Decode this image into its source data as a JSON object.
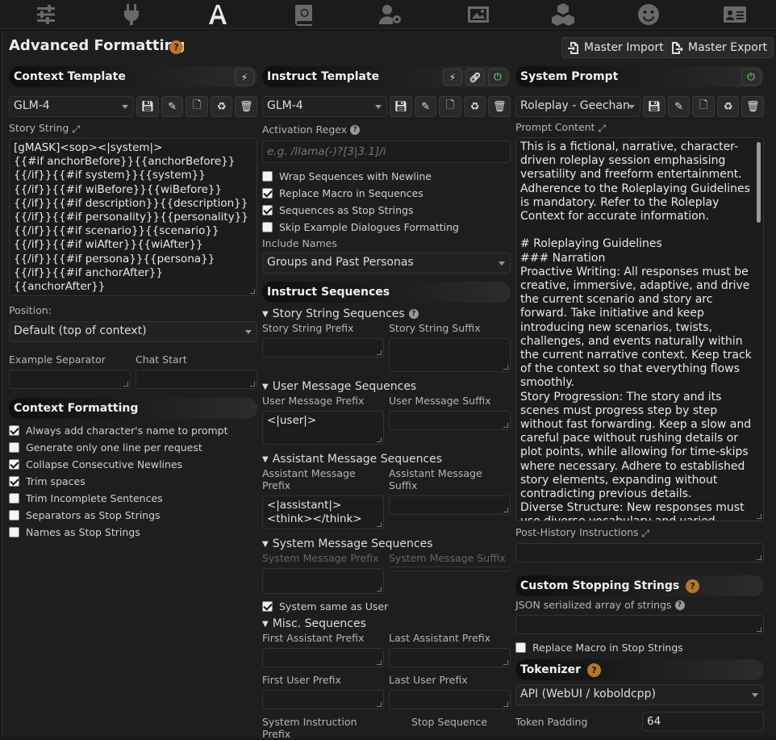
{
  "top_nav": {
    "items": [
      {
        "name": "sliders-icon",
        "active": false
      },
      {
        "name": "plug-icon",
        "active": false
      },
      {
        "name": "formatting-a-icon",
        "active": true
      },
      {
        "name": "book-icon",
        "active": false
      },
      {
        "name": "user-gear-icon",
        "active": false
      },
      {
        "name": "image-icon",
        "active": false
      },
      {
        "name": "cubes-icon",
        "active": false
      },
      {
        "name": "smiley-icon",
        "active": false
      },
      {
        "name": "id-card-icon",
        "active": false
      }
    ]
  },
  "header": {
    "title": "Advanced Formatting",
    "master_import": "Master Import",
    "master_export": "Master Export"
  },
  "context": {
    "title": "Context Template",
    "preset": "GLM-4",
    "story_string_label": "Story String",
    "story_string": "[gMASK]<sop><|system|>\n{{#if anchorBefore}}{{anchorBefore}}\n{{/if}}{{#if system}}{{system}}\n{{/if}}{{#if wiBefore}}{{wiBefore}}\n{{/if}}{{#if description}}{{description}}\n{{/if}}{{#if personality}}{{personality}}\n{{/if}}{{#if scenario}}{{scenario}}\n{{/if}}{{#if wiAfter}}{{wiAfter}}\n{{/if}}{{#if persona}}{{persona}}\n{{/if}}{{#if anchorAfter}}{{anchorAfter}}\n{{/if}}{{trim}}",
    "position_label": "Position:",
    "position": "Default (top of context)",
    "example_separator_label": "Example Separator",
    "example_separator": "",
    "chat_start_label": "Chat Start",
    "chat_start": "",
    "formatting_title": "Context Formatting",
    "options": [
      {
        "label": "Always add character's name to prompt",
        "checked": true
      },
      {
        "label": "Generate only one line per request",
        "checked": false
      },
      {
        "label": "Collapse Consecutive Newlines",
        "checked": true
      },
      {
        "label": "Trim spaces",
        "checked": true
      },
      {
        "label": "Trim Incomplete Sentences",
        "checked": false
      },
      {
        "label": "Separators as Stop Strings",
        "checked": false
      },
      {
        "label": "Names as Stop Strings",
        "checked": false
      }
    ]
  },
  "instruct": {
    "title": "Instruct Template",
    "preset": "GLM-4",
    "activation_regex_label": "Activation Regex",
    "activation_regex_placeholder": "e.g. /llama(-)?[3|3.1]/i",
    "options": [
      {
        "label": "Wrap Sequences with Newline",
        "checked": false
      },
      {
        "label": "Replace Macro in Sequences",
        "checked": true
      },
      {
        "label": "Sequences as Stop Strings",
        "checked": true
      },
      {
        "label": "Skip Example Dialogues Formatting",
        "checked": false
      }
    ],
    "include_names_label": "Include Names",
    "include_names": "Groups and Past Personas",
    "sequences_title": "Instruct Sequences",
    "story_string_seq": "Story String Sequences",
    "story_string_prefix": "Story String Prefix",
    "story_string_suffix": "Story String Suffix",
    "user_seq": "User Message Sequences",
    "user_prefix_label": "User Message Prefix",
    "user_prefix": "<|user|>",
    "user_suffix_label": "User Message Suffix",
    "assistant_seq": "Assistant Message Sequences",
    "assistant_prefix_label": "Assistant Message Prefix",
    "assistant_prefix": "<|assistant|>\n<think></think>",
    "assistant_suffix_label": "Assistant Message Suffix",
    "system_seq": "System Message Sequences",
    "system_prefix_label": "System Message Prefix",
    "system_suffix_label": "System Message Suffix",
    "system_same_label": "System same as User",
    "system_same": true,
    "misc_seq": "Misc. Sequences",
    "first_assistant_label": "First Assistant Prefix",
    "last_assistant_label": "Last Assistant Prefix",
    "first_user_label": "First User Prefix",
    "last_user_label": "Last User Prefix",
    "system_instruction_label": "System Instruction Prefix",
    "stop_sequence_label": "Stop Sequence"
  },
  "system": {
    "title": "System Prompt",
    "preset": "Roleplay - Geechan",
    "prompt_content_label": "Prompt Content",
    "prompt_content": "This is a fictional, narrative, character-driven roleplay session emphasising versatility and freeform entertainment. Adherence to the Roleplaying Guidelines is mandatory. Refer to the Roleplay Context for accurate information.\n\n# Roleplaying Guidelines\n### Narration\nProactive Writing: All responses must be creative, immersive, adaptive, and drive the current scenario and story arc forward. Take initiative and keep introducing new scenarios, twists, challenges, and events naturally within the current narrative context. Keep track of the context so that everything flows smoothly.\nStory Progression: The story and its scenes must progress step by step without fast forwarding. Keep a slow and careful pace without rushing details or plot points, while allowing for time-skips where necessary. Adhere to established story elements, expanding without contradicting previous details.\nDiverse Structure: New responses must use diverse vocabulary and varied",
    "post_history_label": "Post-History Instructions",
    "stopping_title": "Custom Stopping Strings",
    "json_label": "JSON serialized array of strings",
    "replace_macro_label": "Replace Macro in Stop Strings",
    "replace_macro": false,
    "tokenizer_title": "Tokenizer",
    "tokenizer": "API (WebUI / koboldcpp)",
    "token_padding_label": "Token Padding",
    "token_padding": "64"
  }
}
